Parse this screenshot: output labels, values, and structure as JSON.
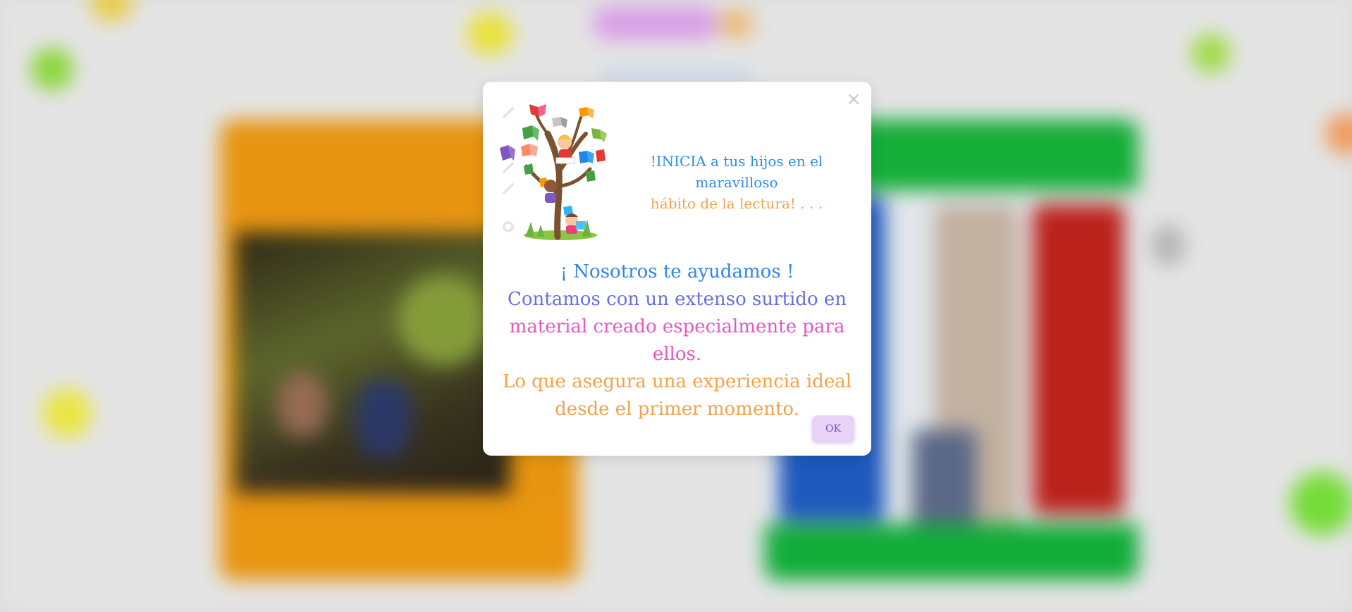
{
  "dialog": {
    "close_symbol": "×",
    "hero_line1": "!INICIA a tus hijos en el maravilloso",
    "hero_line2": "hábito de la lectura! . . .",
    "body_lines": [
      "¡ Nosotros te ayudamos !",
      "Contamos con un extenso surtido en",
      "material creado especialmente para ellos.",
      "Lo que asegura una experiencia ideal",
      "desde el primer momento."
    ],
    "ok_label": "OK",
    "hero_image_icon": "reading-tree-illustration"
  },
  "colors": {
    "hero_line1": "#2d8ee8",
    "hero_line2": "#f3a24a",
    "body_line1": "#2f86e6",
    "body_line2": "#6a6ee0",
    "body_line3": "#ea55c2",
    "body_line4": "#f3a24a",
    "ok_button_bg": "#e7d3f6",
    "background_card_left": "#ef9a12",
    "background_card_right_header": "#15b43a"
  }
}
